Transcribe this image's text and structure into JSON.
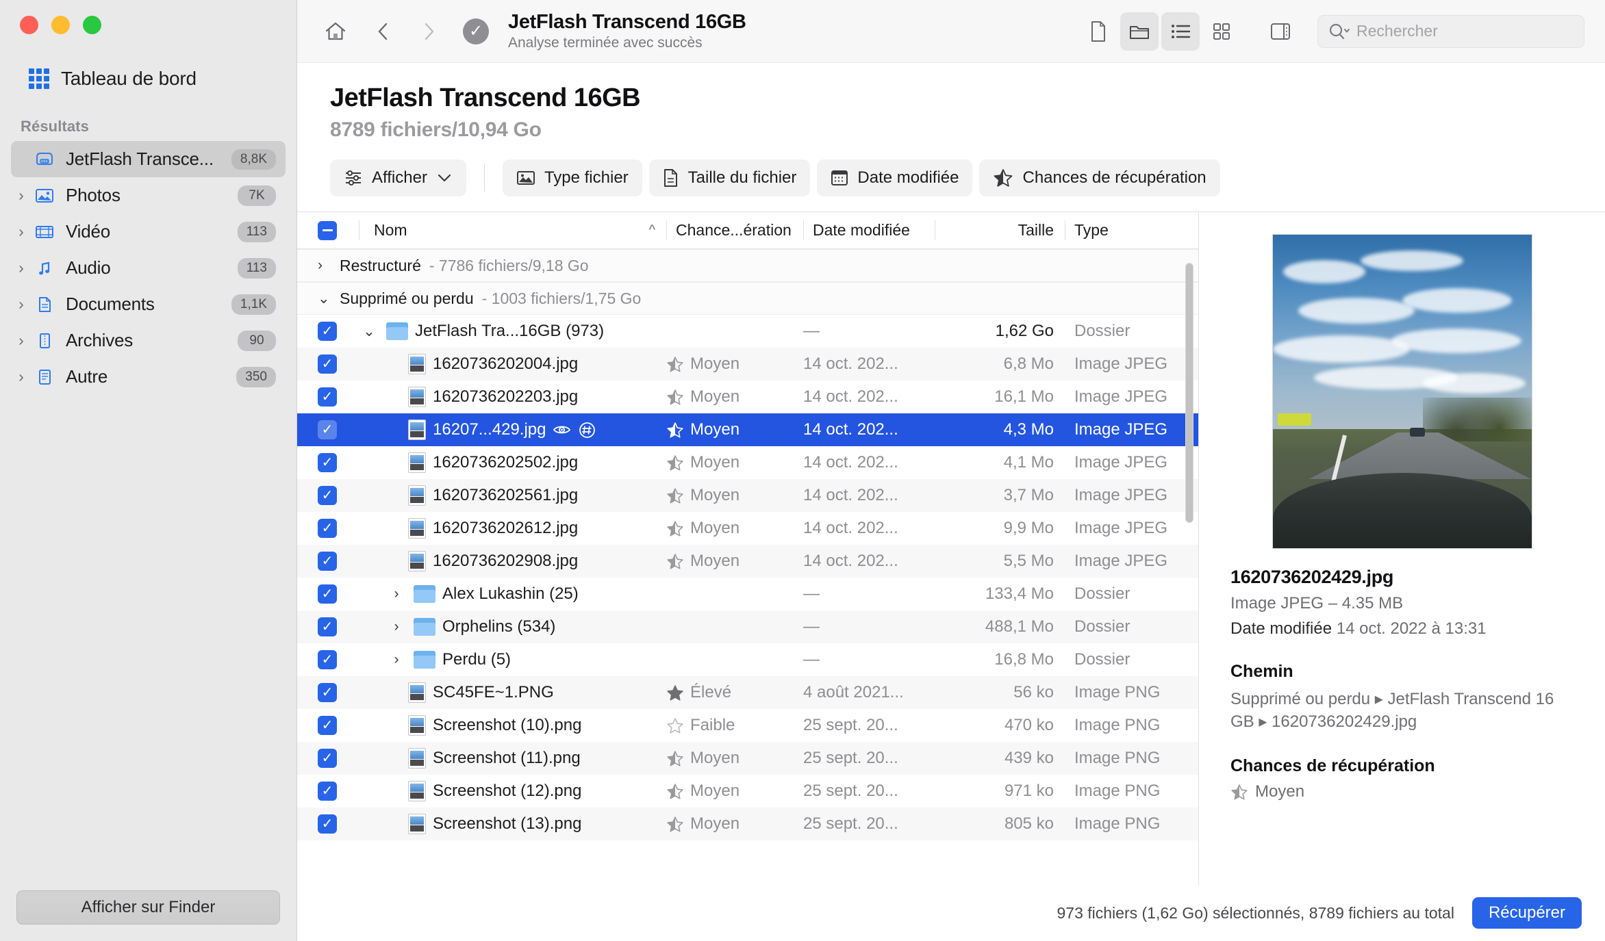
{
  "window": {
    "traffic_lights": [
      "close",
      "minimize",
      "zoom"
    ]
  },
  "sidebar": {
    "dashboard_label": "Tableau de bord",
    "section_title": "Résultats",
    "items": [
      {
        "label": "JetFlash Transce...",
        "badge": "8,8K",
        "icon": "drive-icon",
        "selected": true,
        "expandable": false
      },
      {
        "label": "Photos",
        "badge": "7K",
        "icon": "photos-icon",
        "selected": false,
        "expandable": true
      },
      {
        "label": "Vidéo",
        "badge": "113",
        "icon": "video-icon",
        "selected": false,
        "expandable": true
      },
      {
        "label": "Audio",
        "badge": "113",
        "icon": "audio-icon",
        "selected": false,
        "expandable": true
      },
      {
        "label": "Documents",
        "badge": "1,1K",
        "icon": "document-icon",
        "selected": false,
        "expandable": true
      },
      {
        "label": "Archives",
        "badge": "90",
        "icon": "archive-icon",
        "selected": false,
        "expandable": true
      },
      {
        "label": "Autre",
        "badge": "350",
        "icon": "other-icon",
        "selected": false,
        "expandable": true
      }
    ],
    "finder_button": "Afficher sur Finder"
  },
  "toolbar": {
    "title": "JetFlash Transcend 16GB",
    "subtitle": "Analyse terminée avec succès",
    "search_placeholder": "Rechercher",
    "icons": {
      "home": "home-icon",
      "back": "chevron-left-icon",
      "forward": "chevron-right-icon",
      "status": "check-circle-icon",
      "file_view": "file-view-icon",
      "folder_view": "folder-view-icon",
      "list_view": "list-view-icon",
      "grid_view": "grid-view-icon",
      "panel_toggle": "sidebar-toggle-icon",
      "search": "search-icon"
    }
  },
  "page": {
    "title": "JetFlash Transcend 16GB",
    "subtitle": "8789 fichiers/10,94 Go"
  },
  "filters": [
    {
      "label": "Afficher",
      "icon": "sliders-icon",
      "caret": true
    },
    {
      "label": "Type fichier",
      "icon": "image-icon",
      "caret": false
    },
    {
      "label": "Taille du fichier",
      "icon": "document-icon",
      "caret": false
    },
    {
      "label": "Date modifiée",
      "icon": "calendar-icon",
      "caret": false
    },
    {
      "label": "Chances de récupération",
      "icon": "star-icon",
      "caret": false
    }
  ],
  "table": {
    "columns": [
      "Nom",
      "Chance...ération",
      "Date modifiée",
      "Taille",
      "Type"
    ],
    "sort_indicator": "^",
    "groups": [
      {
        "name": "Restructuré",
        "meta": "- 7786 fichiers/9,18 Go",
        "expanded": false
      },
      {
        "name": "Supprimé ou perdu",
        "meta": "- 1003 fichiers/1,75 Go",
        "expanded": true
      }
    ],
    "rows": [
      {
        "name": "JetFlash Tra...16GB (973)",
        "chance": "",
        "date": "",
        "size": "1,62 Go",
        "type": "Dossier",
        "kind": "folder",
        "indent": 1,
        "twisty": "v",
        "checked": true,
        "selected": false,
        "dash": true,
        "alt": false
      },
      {
        "name": "1620736202004.jpg",
        "chance": "Moyen",
        "date": "14 oct. 202...",
        "size": "6,8 Mo",
        "type": "Image JPEG",
        "kind": "file",
        "indent": 2,
        "twisty": "",
        "checked": true,
        "selected": false,
        "dash": false,
        "alt": true
      },
      {
        "name": "1620736202203.jpg",
        "chance": "Moyen",
        "date": "14 oct. 202...",
        "size": "16,1 Mo",
        "type": "Image JPEG",
        "kind": "file",
        "indent": 2,
        "twisty": "",
        "checked": true,
        "selected": false,
        "dash": false,
        "alt": false
      },
      {
        "name": "16207...429.jpg",
        "chance": "Moyen",
        "date": "14 oct. 202...",
        "size": "4,3 Mo",
        "type": "Image JPEG",
        "kind": "file",
        "indent": 2,
        "twisty": "",
        "checked": true,
        "selected": true,
        "dash": false,
        "alt": false,
        "actions": [
          "eye-icon",
          "hash-icon"
        ]
      },
      {
        "name": "1620736202502.jpg",
        "chance": "Moyen",
        "date": "14 oct. 202...",
        "size": "4,1 Mo",
        "type": "Image JPEG",
        "kind": "file",
        "indent": 2,
        "twisty": "",
        "checked": true,
        "selected": false,
        "dash": false,
        "alt": false
      },
      {
        "name": "1620736202561.jpg",
        "chance": "Moyen",
        "date": "14 oct. 202...",
        "size": "3,7 Mo",
        "type": "Image JPEG",
        "kind": "file",
        "indent": 2,
        "twisty": "",
        "checked": true,
        "selected": false,
        "dash": false,
        "alt": true
      },
      {
        "name": "1620736202612.jpg",
        "chance": "Moyen",
        "date": "14 oct. 202...",
        "size": "9,9 Mo",
        "type": "Image JPEG",
        "kind": "file",
        "indent": 2,
        "twisty": "",
        "checked": true,
        "selected": false,
        "dash": false,
        "alt": false
      },
      {
        "name": "1620736202908.jpg",
        "chance": "Moyen",
        "date": "14 oct. 202...",
        "size": "5,5 Mo",
        "type": "Image JPEG",
        "kind": "file",
        "indent": 2,
        "twisty": "",
        "checked": true,
        "selected": false,
        "dash": false,
        "alt": true
      },
      {
        "name": "Alex Lukashin (25)",
        "chance": "",
        "date": "",
        "size": "133,4 Mo",
        "type": "Dossier",
        "kind": "folder",
        "indent": 2,
        "twisty": ">",
        "checked": true,
        "selected": false,
        "dash": true,
        "alt": false
      },
      {
        "name": "Orphelins (534)",
        "chance": "",
        "date": "",
        "size": "488,1 Mo",
        "type": "Dossier",
        "kind": "folder",
        "indent": 2,
        "twisty": ">",
        "checked": true,
        "selected": false,
        "dash": true,
        "alt": true
      },
      {
        "name": "Perdu (5)",
        "chance": "",
        "date": "",
        "size": "16,8 Mo",
        "type": "Dossier",
        "kind": "folder",
        "indent": 2,
        "twisty": ">",
        "checked": true,
        "selected": false,
        "dash": true,
        "alt": false
      },
      {
        "name": "SC45FE~1.PNG",
        "chance": "Élevé",
        "date": "4 août 2021...",
        "size": "56 ko",
        "type": "Image PNG",
        "kind": "file",
        "indent": 2,
        "twisty": "",
        "checked": true,
        "selected": false,
        "dash": false,
        "alt": true,
        "star": "full"
      },
      {
        "name": "Screenshot (10).png",
        "chance": "Faible",
        "date": "25 sept. 20...",
        "size": "470 ko",
        "type": "Image PNG",
        "kind": "file",
        "indent": 2,
        "twisty": "",
        "checked": true,
        "selected": false,
        "dash": false,
        "alt": false,
        "star": "empty"
      },
      {
        "name": "Screenshot (11).png",
        "chance": "Moyen",
        "date": "25 sept. 20...",
        "size": "439 ko",
        "type": "Image PNG",
        "kind": "file",
        "indent": 2,
        "twisty": "",
        "checked": true,
        "selected": false,
        "dash": false,
        "alt": true
      },
      {
        "name": "Screenshot (12).png",
        "chance": "Moyen",
        "date": "25 sept. 20...",
        "size": "971 ko",
        "type": "Image PNG",
        "kind": "file",
        "indent": 2,
        "twisty": "",
        "checked": true,
        "selected": false,
        "dash": false,
        "alt": false
      },
      {
        "name": "Screenshot (13).png",
        "chance": "Moyen",
        "date": "25 sept. 20...",
        "size": "805 ko",
        "type": "Image PNG",
        "kind": "file",
        "indent": 2,
        "twisty": "",
        "checked": true,
        "selected": false,
        "dash": false,
        "alt": true
      }
    ]
  },
  "preview": {
    "file_name": "1620736202429.jpg",
    "file_info": "Image JPEG – 4.35 MB",
    "date_label": "Date modifiée",
    "date_value": "14 oct. 2022 à 13:31",
    "path_heading": "Chemin",
    "path_value": "Supprimé ou perdu ▸ JetFlash Transcend 16 GB ▸ 1620736202429.jpg",
    "chance_heading": "Chances de récupération",
    "chance_value": "Moyen"
  },
  "status": {
    "text": "973 fichiers (1,62 Go) sélectionnés, 8789 fichiers au total",
    "recover_button": "Récupérer"
  },
  "colors": {
    "accent": "#2764e7",
    "selection": "#2355e0",
    "sidebar_bg": "#e9e9e9",
    "toolbar_bg": "#f7f7f7"
  }
}
